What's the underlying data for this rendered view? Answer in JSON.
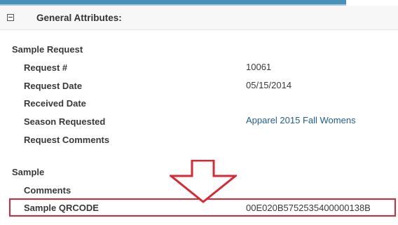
{
  "section": {
    "title": "General Attributes:",
    "toggle_icon": "minus-square-icon"
  },
  "groups": [
    {
      "label": "Sample Request",
      "fields": [
        {
          "label": "Request #",
          "value": "10061"
        },
        {
          "label": "Request Date",
          "value": "05/15/2014"
        },
        {
          "label": "Received Date",
          "value": ""
        },
        {
          "label": "Season Requested",
          "value": "Apparel 2015 Fall Womens"
        },
        {
          "label": "Request Comments",
          "value": ""
        }
      ]
    },
    {
      "label": "Sample",
      "fields": [
        {
          "label": "Comments",
          "value": ""
        },
        {
          "label": "Sample QRCODE",
          "value": "00E020B5752535400000138B"
        }
      ]
    }
  ],
  "annotation": {
    "icon": "down-arrow-icon",
    "color": "#d82a35"
  },
  "colors": {
    "link": "#1f5e96",
    "header_bar": "#4a90b8"
  }
}
